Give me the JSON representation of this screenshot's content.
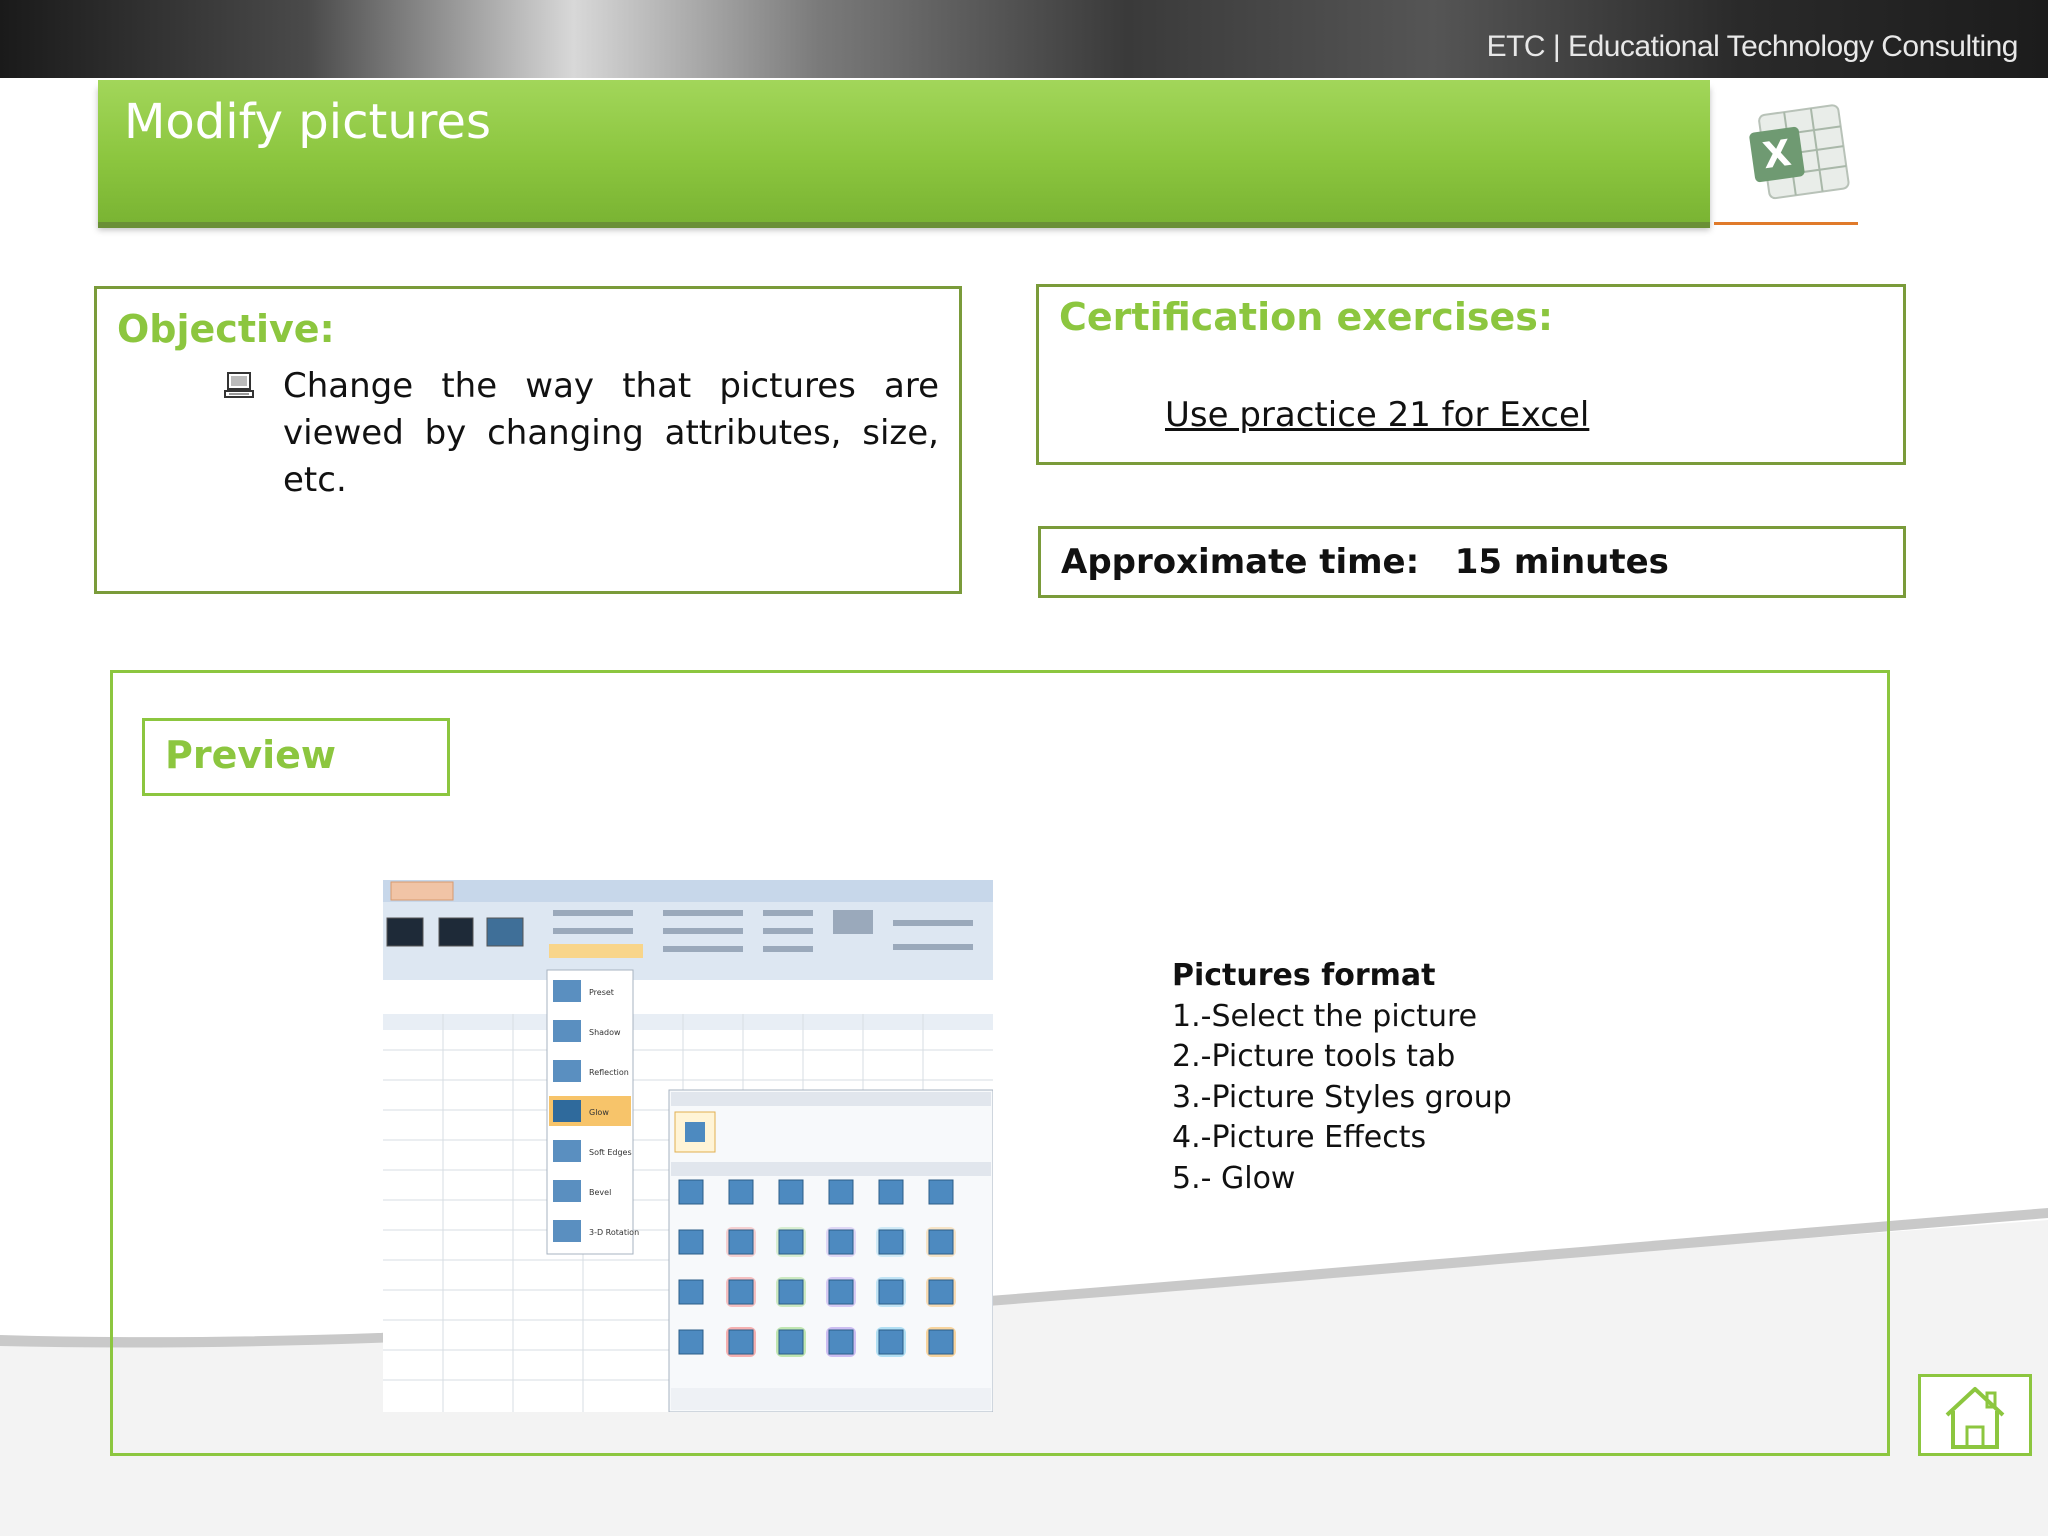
{
  "header": {
    "brand": "ETC | Educational Technology Consulting",
    "title": "Modify pictures",
    "app_icon": "excel-icon"
  },
  "objective": {
    "heading": "Objective:",
    "bullet_icon": "computer-icon",
    "text": "Change the way that pictures are viewed by changing attributes, size, etc."
  },
  "certification": {
    "heading": "Certification exercises:",
    "link": "Use practice  21 for Excel"
  },
  "approximate_time": {
    "text": "Approximate time:   15 minutes"
  },
  "preview": {
    "heading": "Preview",
    "screenshot_menu": [
      "Preset",
      "Shadow",
      "Reflection",
      "Glow",
      "Soft Edges",
      "Bevel",
      "3-D Rotation"
    ],
    "instructions_title": "Pictures format",
    "steps": [
      "1.-Select the picture",
      "2.-Picture tools tab",
      "3.-Picture Styles group",
      "4.-Picture Effects",
      "5.- Glow"
    ]
  },
  "nav": {
    "home_icon": "home-icon"
  },
  "colors": {
    "accent_green": "#8cc63f",
    "box_border": "#7a9b3a",
    "orange_line": "#e07a2a"
  }
}
